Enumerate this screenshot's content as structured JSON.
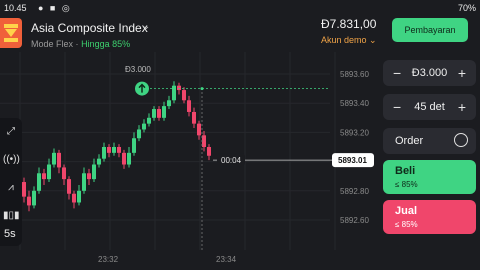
{
  "status_bar": {
    "time": "10.45",
    "right": "70%"
  },
  "header": {
    "asset_name": "Asia Composite Index",
    "mode": "Mode Flex",
    "separator": "·",
    "profit": "Hingga 85%",
    "balance": "Đ7.831,00",
    "account": "Akun demo",
    "pay_label": "Pembayaran"
  },
  "chart": {
    "price_labels": [
      "5893.60",
      "5893.40",
      "5893.20",
      "5893.00",
      "5892.80",
      "5892.60"
    ],
    "current_price": "5893.01",
    "time_labels": [
      "23:32",
      "23:34"
    ],
    "timer": "00:04",
    "trade_amount_label": "Đ3.000",
    "candles": [
      {
        "o": 5892.86,
        "c": 5892.76,
        "h": 5892.89,
        "l": 5892.72
      },
      {
        "o": 5892.76,
        "c": 5892.7,
        "h": 5892.8,
        "l": 5892.66
      },
      {
        "o": 5892.7,
        "c": 5892.8,
        "h": 5892.83,
        "l": 5892.68
      },
      {
        "o": 5892.8,
        "c": 5892.92,
        "h": 5892.96,
        "l": 5892.78
      },
      {
        "o": 5892.92,
        "c": 5892.88,
        "h": 5892.95,
        "l": 5892.84
      },
      {
        "o": 5892.88,
        "c": 5892.98,
        "h": 5893.02,
        "l": 5892.86
      },
      {
        "o": 5892.98,
        "c": 5893.06,
        "h": 5893.09,
        "l": 5892.96
      },
      {
        "o": 5893.06,
        "c": 5892.96,
        "h": 5893.08,
        "l": 5892.92
      },
      {
        "o": 5892.96,
        "c": 5892.88,
        "h": 5892.98,
        "l": 5892.84
      },
      {
        "o": 5892.88,
        "c": 5892.78,
        "h": 5892.9,
        "l": 5892.74
      },
      {
        "o": 5892.78,
        "c": 5892.72,
        "h": 5892.8,
        "l": 5892.68
      },
      {
        "o": 5892.72,
        "c": 5892.8,
        "h": 5892.84,
        "l": 5892.7
      },
      {
        "o": 5892.8,
        "c": 5892.92,
        "h": 5892.96,
        "l": 5892.78
      },
      {
        "o": 5892.92,
        "c": 5892.88,
        "h": 5892.95,
        "l": 5892.84
      },
      {
        "o": 5892.88,
        "c": 5892.98,
        "h": 5893.02,
        "l": 5892.86
      },
      {
        "o": 5892.98,
        "c": 5893.02,
        "h": 5893.05,
        "l": 5892.96
      },
      {
        "o": 5893.02,
        "c": 5893.1,
        "h": 5893.13,
        "l": 5893.0
      },
      {
        "o": 5893.1,
        "c": 5893.06,
        "h": 5893.12,
        "l": 5893.03
      },
      {
        "o": 5893.06,
        "c": 5893.1,
        "h": 5893.13,
        "l": 5893.04
      },
      {
        "o": 5893.1,
        "c": 5893.06,
        "h": 5893.12,
        "l": 5893.03
      },
      {
        "o": 5893.06,
        "c": 5892.98,
        "h": 5893.08,
        "l": 5892.95
      },
      {
        "o": 5892.98,
        "c": 5893.06,
        "h": 5893.1,
        "l": 5892.96
      },
      {
        "o": 5893.06,
        "c": 5893.16,
        "h": 5893.2,
        "l": 5893.04
      },
      {
        "o": 5893.16,
        "c": 5893.22,
        "h": 5893.25,
        "l": 5893.14
      },
      {
        "o": 5893.22,
        "c": 5893.26,
        "h": 5893.29,
        "l": 5893.2
      },
      {
        "o": 5893.26,
        "c": 5893.3,
        "h": 5893.33,
        "l": 5893.24
      },
      {
        "o": 5893.3,
        "c": 5893.36,
        "h": 5893.38,
        "l": 5893.28
      },
      {
        "o": 5893.36,
        "c": 5893.3,
        "h": 5893.38,
        "l": 5893.28
      },
      {
        "o": 5893.3,
        "c": 5893.38,
        "h": 5893.41,
        "l": 5893.28
      },
      {
        "o": 5893.38,
        "c": 5893.42,
        "h": 5893.45,
        "l": 5893.36
      },
      {
        "o": 5893.42,
        "c": 5893.52,
        "h": 5893.55,
        "l": 5893.4
      },
      {
        "o": 5893.52,
        "c": 5893.49,
        "h": 5893.54,
        "l": 5893.46
      },
      {
        "o": 5893.49,
        "c": 5893.42,
        "h": 5893.51,
        "l": 5893.4
      },
      {
        "o": 5893.42,
        "c": 5893.34,
        "h": 5893.45,
        "l": 5893.31
      },
      {
        "o": 5893.34,
        "c": 5893.26,
        "h": 5893.37,
        "l": 5893.23
      },
      {
        "o": 5893.26,
        "c": 5893.18,
        "h": 5893.28,
        "l": 5893.15
      },
      {
        "o": 5893.18,
        "c": 5893.1,
        "h": 5893.21,
        "l": 5893.07
      },
      {
        "o": 5893.1,
        "c": 5893.04,
        "h": 5893.12,
        "l": 5893.01
      }
    ]
  },
  "tools": [
    {
      "icon": "expand-icon"
    },
    {
      "icon": "broadcast-icon"
    },
    {
      "icon": "drawing-icon"
    },
    {
      "icon": "indicators-icon"
    }
  ],
  "tool_timeframe": "5s",
  "panel": {
    "amount": "Đ3.000",
    "time": "45 det",
    "order_label": "Order",
    "buy_label": "Beli",
    "buy_payout": "≤ 85%",
    "sell_label": "Jual",
    "sell_payout": "≤ 85%"
  },
  "colors": {
    "background": "#1b1c20",
    "green": "#3fd483",
    "red": "#f0466b",
    "accent_orange": "#f0603a",
    "account_orange": "#f0a347"
  }
}
